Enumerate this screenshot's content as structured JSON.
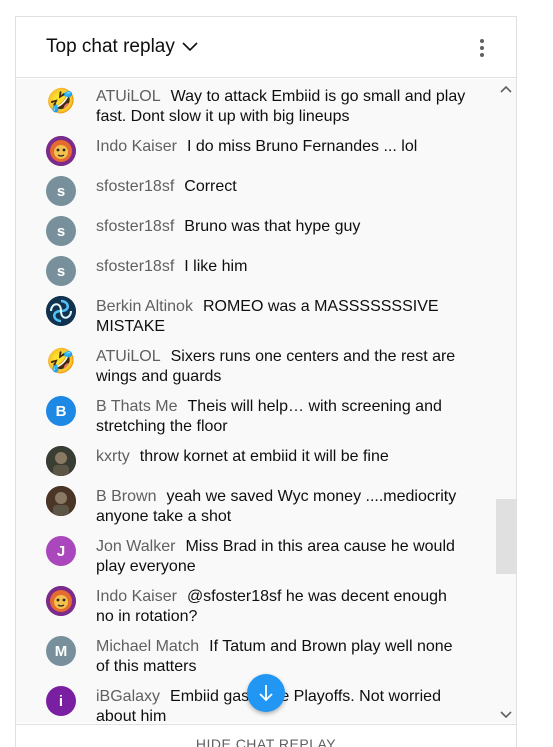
{
  "header": {
    "title": "Top chat replay"
  },
  "messages": [
    {
      "author": "ATUiLOL",
      "text": "Way to attack Embiid is go small and play fast. Dont slow it up with big lineups",
      "avatar": {
        "type": "emoji",
        "glyph": "🤣"
      }
    },
    {
      "author": "Indo Kaiser",
      "text": "I do miss Bruno Fernandes ... lol",
      "avatar": {
        "type": "image",
        "icon": "lion-avatar",
        "color": "#7b2b8c"
      }
    },
    {
      "author": "sfoster18sf",
      "text": "Correct",
      "avatar": {
        "type": "letter",
        "letter": "s",
        "color": "#78909c"
      }
    },
    {
      "author": "sfoster18sf",
      "text": "Bruno was that hype guy",
      "avatar": {
        "type": "letter",
        "letter": "s",
        "color": "#78909c"
      }
    },
    {
      "author": "sfoster18sf",
      "text": "I like him",
      "avatar": {
        "type": "letter",
        "letter": "s",
        "color": "#78909c"
      }
    },
    {
      "author": "Berkin Altinok",
      "text": "ROMEO was a MASSSSSSSIVE MISTAKE",
      "avatar": {
        "type": "image",
        "icon": "swirl-avatar",
        "color": "#12334f"
      }
    },
    {
      "author": "ATUiLOL",
      "text": "Sixers runs one centers and the rest are wings and guards",
      "avatar": {
        "type": "emoji",
        "glyph": "🤣"
      }
    },
    {
      "author": "B Thats Me",
      "text": "Theis will help… with screening and stretching the floor",
      "avatar": {
        "type": "letter",
        "letter": "B",
        "color": "#1e88e5"
      }
    },
    {
      "author": "kxrty",
      "text": "throw kornet at embiid it will be fine",
      "avatar": {
        "type": "image",
        "icon": "photo-avatar",
        "color": "#3a3d33"
      }
    },
    {
      "author": "B Brown",
      "text": "yeah we saved Wyc money ....mediocrity anyone take a shot",
      "avatar": {
        "type": "image",
        "icon": "photo-avatar",
        "color": "#4a3527"
      }
    },
    {
      "author": "Jon Walker",
      "text": "Miss Brad in this area cause he would play everyone",
      "avatar": {
        "type": "letter",
        "letter": "J",
        "color": "#ab47bc"
      }
    },
    {
      "author": "Indo Kaiser",
      "text": "@sfoster18sf he was decent enough no in rotation?",
      "avatar": {
        "type": "image",
        "icon": "lion-avatar",
        "color": "#7b2b8c"
      }
    },
    {
      "author": "Michael Match",
      "text": "If Tatum and Brown play well none of this matters",
      "avatar": {
        "type": "letter",
        "letter": "M",
        "color": "#78909c"
      }
    },
    {
      "author": "iBGalaxy",
      "text": "Embiid gas    n the Playoffs. Not worried about him",
      "avatar": {
        "type": "letter",
        "letter": "i",
        "color": "#7b1fa2"
      }
    }
  ],
  "footer": {
    "hide_label": "HIDE CHAT REPLAY"
  },
  "colors": {
    "accent": "#2196f3",
    "author": "#606060",
    "chat_bg": "#f9f9f9"
  }
}
